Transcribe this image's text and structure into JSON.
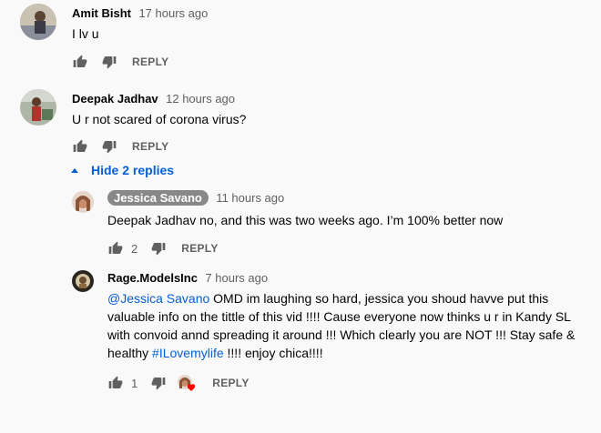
{
  "comments": [
    {
      "author": "Amit Bisht",
      "time": "17 hours ago",
      "text": "I lv u",
      "reply_label": "REPLY"
    },
    {
      "author": "Deepak Jadhav",
      "time": "12 hours ago",
      "text": "U r not scared of corona virus?",
      "reply_label": "REPLY",
      "hide_replies_label": "Hide 2 replies",
      "replies": [
        {
          "author": "Jessica Savano",
          "time": "11 hours ago",
          "text": "Deepak Jadhav no, and this was two weeks ago. I’m 100% better now",
          "likes": "2",
          "reply_label": "REPLY"
        },
        {
          "author": "Rage.ModelsInc",
          "time": "7 hours ago",
          "mention": "@Jessica Savano",
          "text_part1": " OMD im laughing so hard, jessica you  shoud havve put this valuable info on the tittle of this vid !!!! Cause everyone now thinks u r in Kandy SL with convoid annd spreading it around !!! Which clearly you are NOT !!! Stay safe & healthy ",
          "hashtag": "#ILovemylife",
          "text_part2": " !!!! enjoy chica!!!!",
          "likes": "1",
          "reply_label": "REPLY"
        }
      ]
    }
  ]
}
